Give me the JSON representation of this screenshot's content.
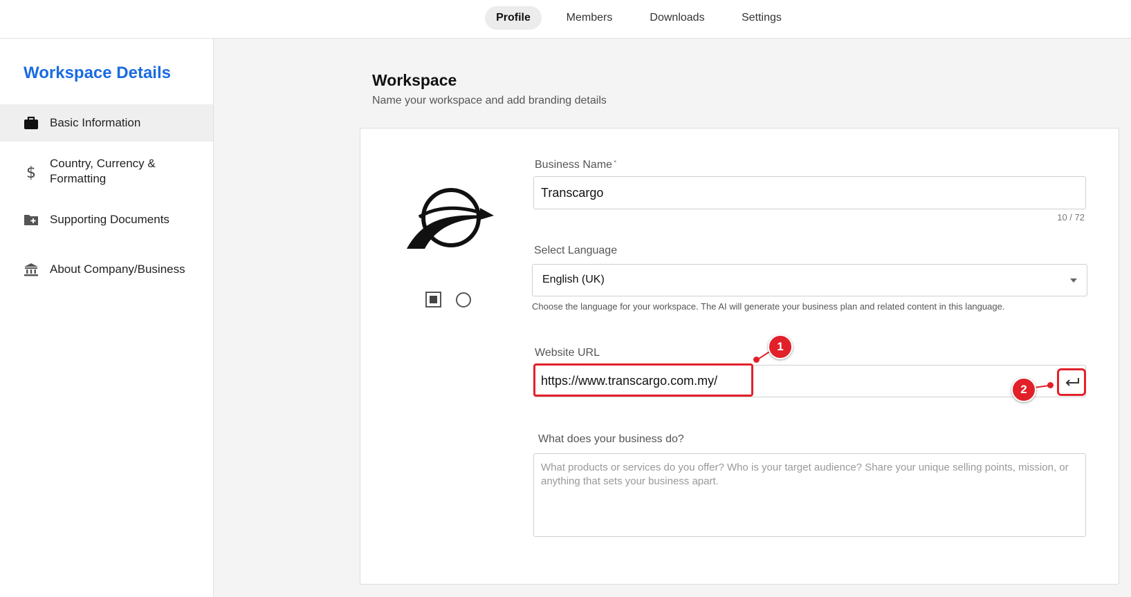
{
  "nav": {
    "tabs": [
      {
        "label": "Profile",
        "active": true
      },
      {
        "label": "Members",
        "active": false
      },
      {
        "label": "Downloads",
        "active": false
      },
      {
        "label": "Settings",
        "active": false
      }
    ]
  },
  "sidebar": {
    "title": "Workspace Details",
    "items": [
      {
        "label": "Basic Information",
        "icon": "briefcase-icon",
        "active": true
      },
      {
        "label": "Country, Currency & Formatting",
        "icon": "dollar-icon",
        "active": false
      },
      {
        "label": "Supporting Documents",
        "icon": "folder-plus-icon",
        "active": false
      },
      {
        "label": "About Company/Business",
        "icon": "bank-icon",
        "active": false
      }
    ]
  },
  "main": {
    "title": "Workspace",
    "subtitle": "Name your workspace and add branding details"
  },
  "form": {
    "business_name": {
      "label": "Business Name",
      "required_mark": "*",
      "value": "Transcargo",
      "counter": "10 / 72"
    },
    "language": {
      "label": "Select Language",
      "value": "English (UK)",
      "helper": "Choose the language for your workspace. The AI will generate your business plan and related content in this language."
    },
    "website": {
      "label": "Website URL",
      "value": "https://www.transcargo.com.my/"
    },
    "description": {
      "label": "What does your business do?",
      "placeholder": "What products or services do you offer? Who is your target audience? Share your unique selling points, mission, or anything that sets your business apart.",
      "value": ""
    }
  },
  "annotations": {
    "badge_1": "1",
    "badge_2": "2",
    "accent": "#e2202a"
  },
  "colors": {
    "brand_blue": "#1a6be0"
  }
}
